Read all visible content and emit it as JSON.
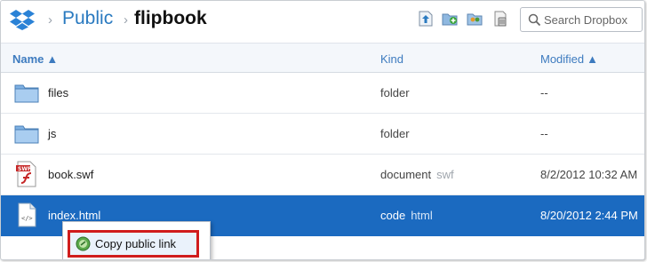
{
  "breadcrumb": {
    "root": "Public",
    "current": "flipbook"
  },
  "toolbar": {
    "icons": [
      "upload-icon",
      "new-folder-icon",
      "share-folder-icon",
      "show-deleted-icon"
    ]
  },
  "search": {
    "placeholder": "Search Dropbox"
  },
  "columns": {
    "name": "Name",
    "kind": "Kind",
    "modified": "Modified"
  },
  "files": [
    {
      "name": "files",
      "kind": "folder",
      "ext": "",
      "modified": "--",
      "icon": "folder-icon"
    },
    {
      "name": "js",
      "kind": "folder",
      "ext": "",
      "modified": "--",
      "icon": "folder-icon"
    },
    {
      "name": "book.swf",
      "kind": "document",
      "ext": "swf",
      "modified": "8/2/2012 10:32 AM",
      "icon": "swf-file-icon"
    },
    {
      "name": "index.html",
      "kind": "code",
      "ext": "html",
      "modified": "8/20/2012 2:44 PM",
      "icon": "html-file-icon",
      "selected": true
    }
  ],
  "context_menu": {
    "item_label": "Copy public link",
    "highlight_color": "#d01c1c"
  },
  "colors": {
    "accent": "#2a7ac0",
    "selection": "#1b6ac0"
  }
}
